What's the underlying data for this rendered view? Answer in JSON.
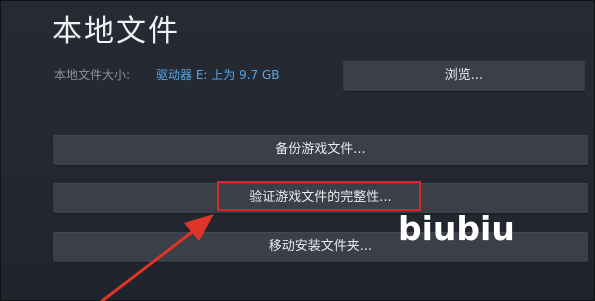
{
  "section": {
    "title": "本地文件",
    "size_label": "本地文件大小:",
    "size_value": "驱动器 E: 上为 9.7 GB"
  },
  "buttons": {
    "browse": "浏览...",
    "backup": "备份游戏文件...",
    "verify": "验证游戏文件的完整性...",
    "move": "移动安装文件夹..."
  },
  "watermark": "biubiu",
  "colors": {
    "background": "#232831",
    "button": "#3a3f48",
    "accent_link": "#58a6e8",
    "highlight": "#d8262b"
  }
}
